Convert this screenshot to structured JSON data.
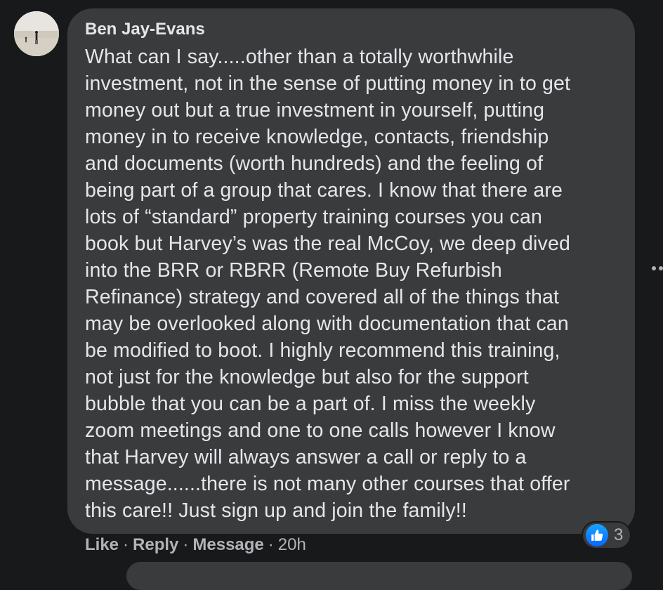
{
  "comment": {
    "author": "Ben Jay-Evans",
    "text_lines": [
      "What can I say.....other than a totally worthwhile",
      "investment, not in the sense of putting money in to get",
      "money out but a true investment in yourself, putting",
      "money in to receive knowledge, contacts, friendship",
      "and documents (worth hundreds) and the feeling of",
      "being part of a group that cares. I know that there are",
      "lots of “standard” property training courses you can",
      "book but Harvey’s was the real McCoy, we deep dived",
      "into the BRR or RBRR (Remote Buy Refurbish",
      "Refinance) strategy and covered all of the things that",
      "may be overlooked along with documentation that can",
      "be modified to boot. I highly recommend this training,",
      "not just for the knowledge but also for the support",
      "bubble that you can be a part of. I miss the weekly",
      "zoom meetings and one to one calls however I know",
      "that Harvey will always answer a call or reply to a",
      "message......there is not many other courses that offer",
      "this care!! Just sign up and join the family!!"
    ],
    "reaction_icon": "thumbs-up-icon",
    "reaction_count": "3",
    "actions": {
      "like": "Like",
      "reply": "Reply",
      "message": "Message",
      "timestamp": "20h",
      "separator": "·"
    }
  },
  "colors": {
    "background": "#18191a",
    "bubble": "#3a3b3c",
    "text": "#e4e6eb",
    "secondary_text": "#b0b3b8",
    "like_blue": "#0866ff"
  }
}
